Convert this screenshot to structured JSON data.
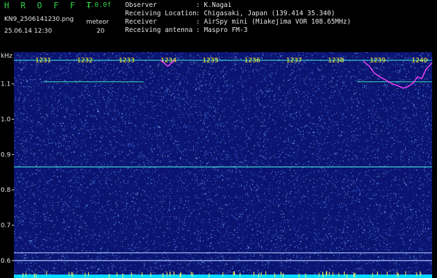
{
  "header": {
    "logo": "H R O F F T",
    "version": "1.0.0f",
    "file": "KN9_2506141230.png",
    "datetime": "25.06.14 12:30",
    "meteor_label": "meteor",
    "meteor_count": "20",
    "info": [
      {
        "key": "Observer",
        "value": ": K.Nagai"
      },
      {
        "key": "Receiving Location",
        "value": ": Chigasaki, Japan (139.414 35.340)"
      },
      {
        "key": "Receiver",
        "value": ": AirSpy mini (Miakejima VOR 108.65MHz)"
      },
      {
        "key": "Receiving antenna",
        "value": ": Maspro FM-3"
      }
    ]
  },
  "colors": {
    "background": "#000000",
    "spectrogram_base": "#0b1470",
    "noise_speck": "#4a86ff",
    "carrier_line": "#3fd7d0",
    "minute_labels": "#ffff2a",
    "text": "#e6e6e6",
    "logo": "#2ed04a",
    "baseline": "#00d8ff"
  },
  "chart_data": {
    "type": "heatmap",
    "title": "",
    "ylabel": "kHz",
    "ylim": [
      0.59,
      1.18
    ],
    "yticks": [
      "1.1",
      "1.0",
      "0.9",
      "0.8",
      "0.7",
      "0.6"
    ],
    "ytick_values": [
      1.1,
      1.0,
      0.9,
      0.8,
      0.7,
      0.6
    ],
    "minute_labels": [
      "1231",
      "1232",
      "1233",
      "1234",
      "1235",
      "1236",
      "1237",
      "1238",
      "1239",
      "1240"
    ],
    "grid": false,
    "features": [
      {
        "kind": "horizontal_line",
        "freq_khz": 1.167,
        "t_start": 0.0,
        "t_end": 1.0,
        "color": "#3fd7d0"
      },
      {
        "kind": "horizontal_line",
        "freq_khz": 1.106,
        "t_start": 0.07,
        "t_end": 0.31,
        "color": "#39c9a8"
      },
      {
        "kind": "horizontal_line",
        "freq_khz": 1.106,
        "t_start": 0.82,
        "t_end": 1.0,
        "color": "#39c9a8"
      },
      {
        "kind": "horizontal_line",
        "freq_khz": 0.865,
        "t_start": 0.0,
        "t_end": 1.0,
        "color": "#3fd7d0"
      },
      {
        "kind": "horizontal_line",
        "freq_khz": 0.622,
        "t_start": 0.0,
        "t_end": 1.0,
        "color": "#b0c8ff"
      },
      {
        "kind": "horizontal_line",
        "freq_khz": 0.6,
        "t_start": 0.0,
        "t_end": 1.0,
        "color": "#b0c8ff"
      }
    ],
    "doppler_trace": {
      "color": "#ff40ff",
      "points": [
        [
          0.835,
          1.165
        ],
        [
          0.85,
          1.15
        ],
        [
          0.862,
          1.13
        ],
        [
          0.875,
          1.12
        ],
        [
          0.89,
          1.11
        ],
        [
          0.905,
          1.1
        ],
        [
          0.918,
          1.095
        ],
        [
          0.93,
          1.088
        ],
        [
          0.942,
          1.092
        ],
        [
          0.955,
          1.103
        ],
        [
          0.965,
          1.12
        ],
        [
          0.975,
          1.115
        ],
        [
          0.985,
          1.14
        ],
        [
          1.0,
          1.16
        ]
      ]
    },
    "dip_trace": {
      "color": "#ff40ff",
      "points": [
        [
          0.35,
          1.168
        ],
        [
          0.36,
          1.158
        ],
        [
          0.368,
          1.15
        ],
        [
          0.376,
          1.158
        ],
        [
          0.385,
          1.168
        ]
      ]
    }
  }
}
